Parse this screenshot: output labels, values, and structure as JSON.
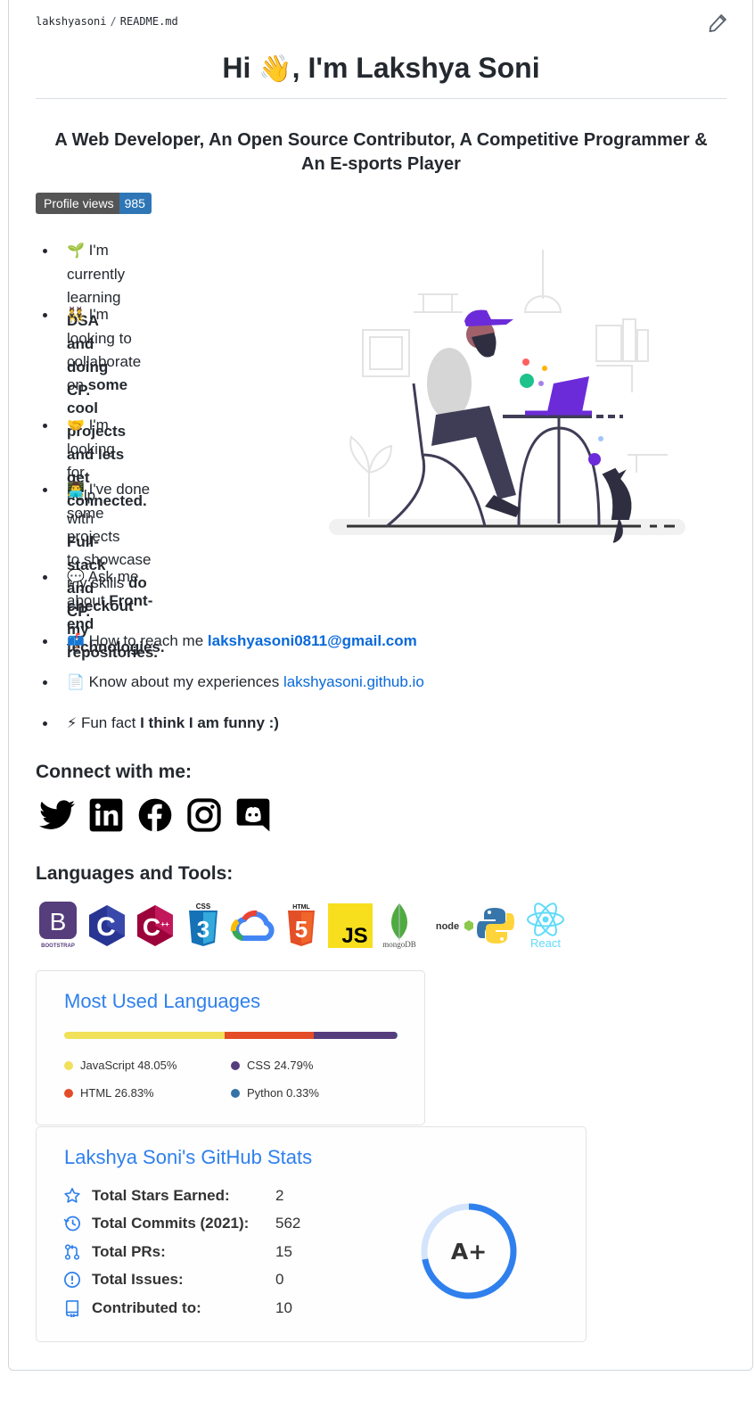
{
  "breadcrumb": {
    "user": "lakshyasoni",
    "sep": "/",
    "file": "README.md"
  },
  "title": {
    "before": "Hi ",
    "emoji": "👋",
    "after": ", I'm Lakshya Soni"
  },
  "subtitle": {
    "line1": "A Web Developer, An Open Source Contributor, A Competitive Programmer &",
    "line2": "An E-sports Player"
  },
  "badge": {
    "label": "Profile views",
    "count": "985"
  },
  "facts": [
    {
      "emoji": "🌱",
      "l1a": "I'm currently learning",
      "l2b": "DSA and doing CP."
    },
    {
      "emoji": "👯",
      "l1a": "I'm looking to",
      "l2a": "collaborate on ",
      "l2b": "some cool",
      "l3b": "projects and lets get",
      "l4b": "connected."
    },
    {
      "emoji": "🤝",
      "l1a": "I'm looking for help",
      "l2a": "with ",
      "l2b": "Full-stack and CP."
    },
    {
      "emoji": "👨‍💻",
      "l1a": "I've done some projects",
      "l2a": "to showcase my skills ",
      "l2b": "do",
      "l3b": "checkout my repositories."
    },
    {
      "emoji": "💬",
      "l1a": "Ask me about ",
      "l1b": "Front-",
      "l2b": "end technologies."
    },
    {
      "emoji": "📫",
      "l1a": "How to reach me ",
      "link": "lakshyasoni0811@gmail.com"
    },
    {
      "emoji": "📄",
      "l1a": "Know about my experiences ",
      "link": "lakshyasoni.github.io"
    },
    {
      "emoji": "⚡",
      "l1a": "Fun fact ",
      "l1b": "I think I am funny :)"
    }
  ],
  "connect": {
    "heading": "Connect with me:",
    "icons": [
      "twitter-icon",
      "linkedin-icon",
      "facebook-icon",
      "instagram-icon",
      "discord-icon"
    ]
  },
  "tools": {
    "heading": "Languages and Tools:",
    "items": [
      {
        "name": "bootstrap",
        "mark": "B",
        "caption": "BOOTSTRAP",
        "color": "#563d7c"
      },
      {
        "name": "c",
        "mark": "C",
        "color": "#283593"
      },
      {
        "name": "cplusplus",
        "mark": "C",
        "sup": "++",
        "color": "#9c033a"
      },
      {
        "name": "css3",
        "mark": "3",
        "caption": "CSS",
        "color": "#1572b6"
      },
      {
        "name": "gcp",
        "mark": "",
        "color": "#4285f4"
      },
      {
        "name": "html5",
        "mark": "5",
        "caption": "HTML",
        "color": "#e34f26"
      },
      {
        "name": "javascript",
        "mark": "JS",
        "color": "#f7df1e"
      },
      {
        "name": "mongodb",
        "mark": "",
        "caption": "mongoDB",
        "color": "#4faa41"
      },
      {
        "name": "nodejs",
        "mark": "node",
        "color": "#333333"
      },
      {
        "name": "python",
        "mark": "",
        "color": "#3776ab"
      },
      {
        "name": "react",
        "mark": "",
        "caption": "React",
        "color": "#61dafb"
      }
    ]
  },
  "languages_card": {
    "title": "Most Used Languages",
    "items": [
      {
        "name": "JavaScript",
        "percent": 48.05,
        "label": "JavaScript 48.05%",
        "color": "#f1e05a"
      },
      {
        "name": "HTML",
        "percent": 26.83,
        "label": "HTML 26.83%",
        "color": "#e34c26"
      },
      {
        "name": "CSS",
        "percent": 24.79,
        "label": "CSS 24.79%",
        "color": "#563d7c"
      },
      {
        "name": "Python",
        "percent": 0.33,
        "label": "Python 0.33%",
        "color": "#3572a5"
      }
    ]
  },
  "stats_card": {
    "title": "Lakshya Soni's GitHub Stats",
    "rows": [
      {
        "icon": "star-icon",
        "label": "Total Stars Earned:",
        "value": "2"
      },
      {
        "icon": "history-icon",
        "label": "Total Commits (2021):",
        "value": "562"
      },
      {
        "icon": "pull-request-icon",
        "label": "Total PRs:",
        "value": "15"
      },
      {
        "icon": "issue-icon",
        "label": "Total Issues:",
        "value": "0"
      },
      {
        "icon": "repo-icon",
        "label": "Contributed to:",
        "value": "10"
      }
    ],
    "grade": "A+",
    "grade_progress": 0.72,
    "accent": "#2f80ed"
  }
}
